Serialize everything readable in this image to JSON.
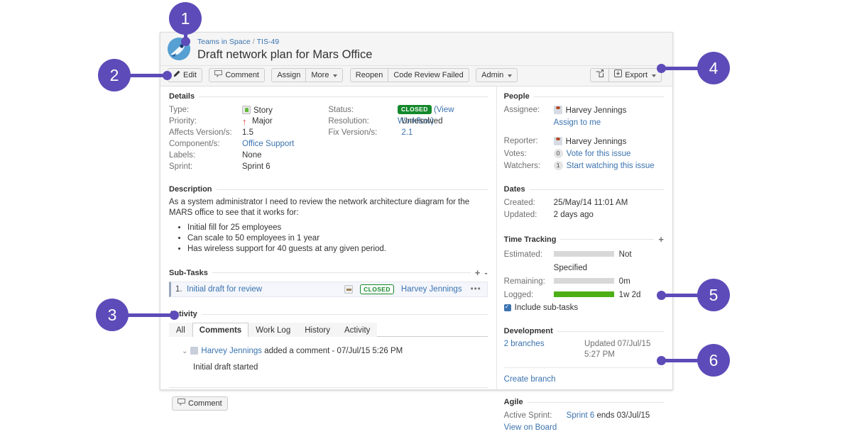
{
  "breadcrumb": {
    "project": "Teams in Space",
    "separator": "/",
    "issue_key": "TIS-49"
  },
  "issue": {
    "title": "Draft network plan for Mars Office"
  },
  "toolbar": {
    "edit": "Edit",
    "comment": "Comment",
    "assign": "Assign",
    "more": "More",
    "reopen": "Reopen",
    "code_review_failed": "Code Review Failed",
    "admin": "Admin",
    "export": "Export"
  },
  "details": {
    "heading": "Details",
    "left": [
      {
        "label": "Type:",
        "value": "Story"
      },
      {
        "label": "Priority:",
        "value": "Major"
      },
      {
        "label": "Affects Version/s:",
        "value": "1.5"
      },
      {
        "label": "Component/s:",
        "value": "Office Support"
      },
      {
        "label": "Labels:",
        "value": "None"
      },
      {
        "label": "Sprint:",
        "value": "Sprint 6"
      }
    ],
    "right": [
      {
        "label": "Status:",
        "value": "CLOSED",
        "link": "(View Workflow)"
      },
      {
        "label": "Resolution:",
        "value": "Unresolved"
      },
      {
        "label": "Fix Version/s:",
        "value": "2.1"
      }
    ]
  },
  "description": {
    "heading": "Description",
    "paragraph": "As a system administrator I need to review the network architecture diagram for the MARS office to see that it works for:",
    "bullets": [
      "Initial fill for 25 employees",
      "Can scale to 50 employees in 1 year",
      "Has wireless support for 40 guests at any given period."
    ]
  },
  "subtasks": {
    "heading": "Sub-Tasks",
    "add_icon": "+",
    "collapse_icon": "-",
    "rows": [
      {
        "num": "1.",
        "title": "Initial draft for review",
        "status": "CLOSED",
        "assignee": "Harvey Jennings",
        "menu": "•••"
      }
    ]
  },
  "activity": {
    "heading": "Activity",
    "tabs": [
      {
        "label": "All",
        "active": false
      },
      {
        "label": "Comments",
        "active": true
      },
      {
        "label": "Work Log",
        "active": false
      },
      {
        "label": "History",
        "active": false
      },
      {
        "label": "Activity",
        "active": false
      }
    ],
    "comment": {
      "author": "Harvey Jennings",
      "action": "added a comment -",
      "timestamp": "07/Jul/15 5:26 PM",
      "body": "Initial draft started"
    },
    "footer_button": "Comment"
  },
  "people": {
    "heading": "People",
    "assignee_label": "Assignee:",
    "assignee_value": "Harvey Jennings",
    "assign_to_me": "Assign to me",
    "reporter_label": "Reporter:",
    "reporter_value": "Harvey Jennings",
    "votes_label": "Votes:",
    "votes_count": "0",
    "votes_link": "Vote for this issue",
    "watchers_label": "Watchers:",
    "watchers_count": "1",
    "watchers_link": "Start watching this issue"
  },
  "dates": {
    "heading": "Dates",
    "created_label": "Created:",
    "created_value": "25/May/14 11:01 AM",
    "updated_label": "Updated:",
    "updated_value": "2 days ago"
  },
  "time_tracking": {
    "heading": "Time Tracking",
    "add_icon": "+",
    "estimated_label": "Estimated:",
    "estimated_value": "Not Specified",
    "remaining_label": "Remaining:",
    "remaining_value": "0m",
    "logged_label": "Logged:",
    "logged_value": "1w 2d",
    "include_subtasks": "Include sub-tasks"
  },
  "development": {
    "heading": "Development",
    "branches": "2 branches",
    "updated": "Updated 07/Jul/15 5:27 PM",
    "create_branch": "Create branch"
  },
  "agile": {
    "heading": "Agile",
    "active_sprint_label": "Active Sprint:",
    "sprint_link": "Sprint 6",
    "sprint_suffix": "ends 03/Jul/15",
    "view_on_board": "View on Board"
  },
  "callouts": [
    {
      "number": "1"
    },
    {
      "number": "2"
    },
    {
      "number": "3"
    },
    {
      "number": "4"
    },
    {
      "number": "5"
    },
    {
      "number": "6"
    }
  ],
  "colors": {
    "callout_purple": "#5c4bb8",
    "status_green": "#14892c",
    "link_blue": "#3b73af",
    "logged_green": "#4caf15"
  }
}
